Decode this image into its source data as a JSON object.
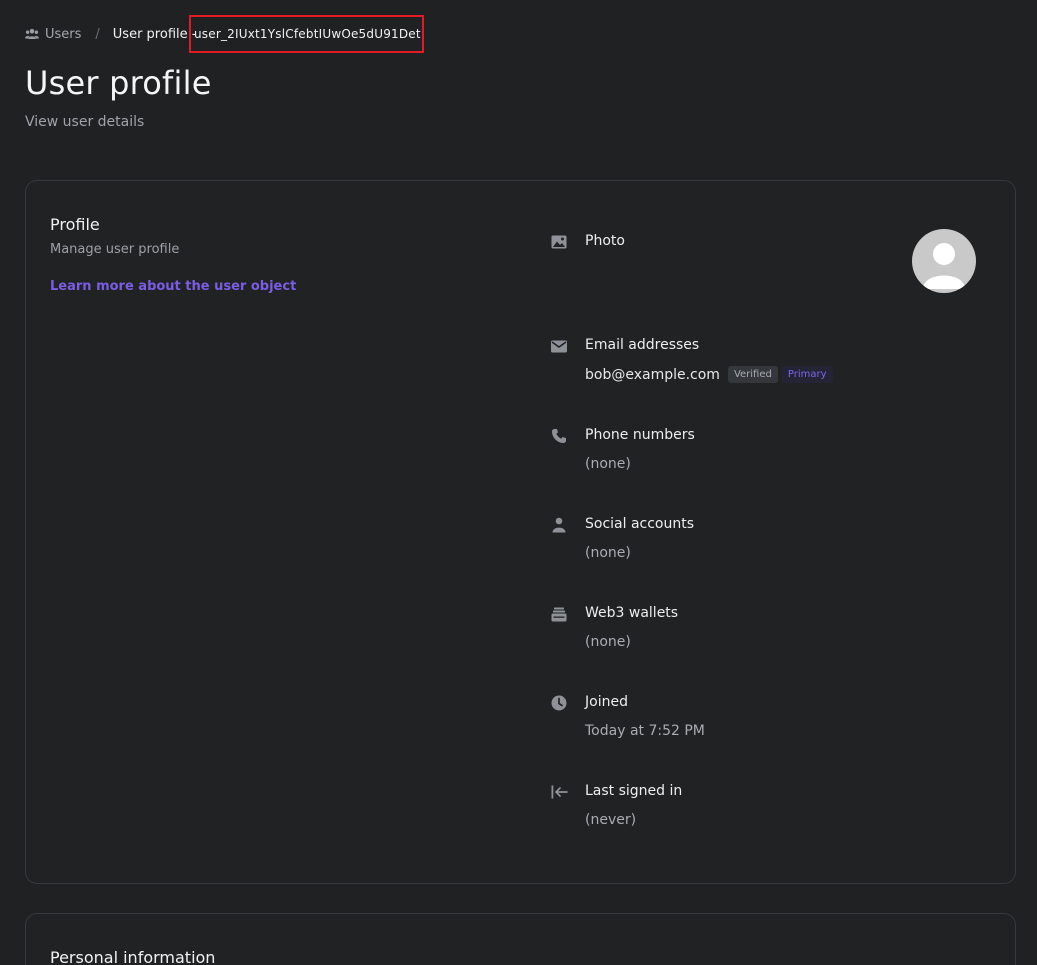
{
  "breadcrumb": {
    "users_label": "Users",
    "separator": "/",
    "current_label": "User profile -",
    "user_id": "user_2IUxt1YslCfebtIUwOe5dU91Det"
  },
  "header": {
    "title": "User profile",
    "subtitle": "View user details"
  },
  "profile_card": {
    "title": "Profile",
    "description": "Manage user profile",
    "learn_more_link": "Learn more about the user object",
    "fields": {
      "photo": {
        "label": "Photo",
        "icon": "image-icon"
      },
      "email": {
        "label": "Email addresses",
        "icon": "mail-icon",
        "value": "bob@example.com",
        "badge_verified": "Verified",
        "badge_primary": "Primary"
      },
      "phone": {
        "label": "Phone numbers",
        "icon": "phone-icon",
        "value": "(none)"
      },
      "social": {
        "label": "Social accounts",
        "icon": "person-icon",
        "value": "(none)"
      },
      "web3": {
        "label": "Web3 wallets",
        "icon": "wallet-icon",
        "value": "(none)"
      },
      "joined": {
        "label": "Joined",
        "icon": "clock-icon",
        "value": "Today at 7:52 PM"
      },
      "last_signed_in": {
        "label": "Last signed in",
        "icon": "sign-in-icon",
        "value": "(never)"
      }
    }
  },
  "personal_card": {
    "title": "Personal information"
  },
  "colors": {
    "background": "#1f2123",
    "accent": "#7b5ce5",
    "highlight_box": "#e01b24"
  }
}
